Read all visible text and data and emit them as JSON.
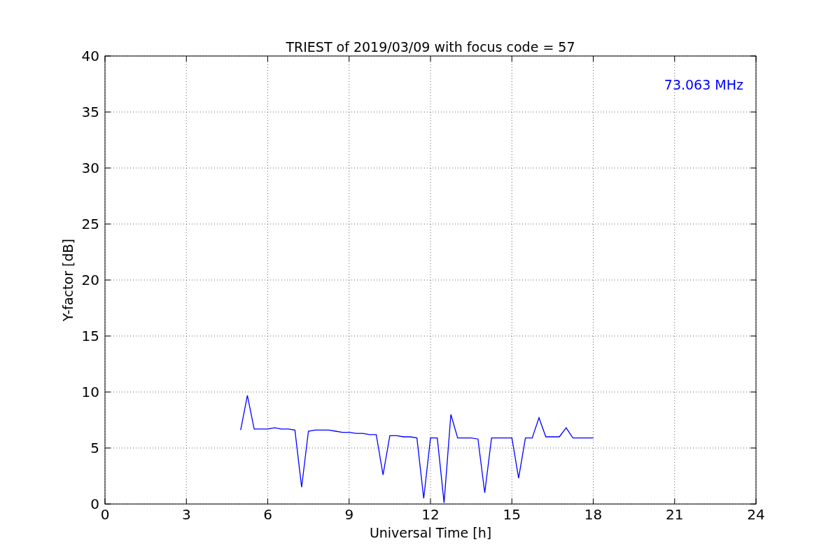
{
  "figure": {
    "chart_data": {
      "type": "line",
      "title": "TRIEST of 2019/03/09 with focus code = 57",
      "xlabel": "Universal Time [h]",
      "ylabel": "Y-factor [dB]",
      "x": [
        5,
        5.25,
        5.5,
        5.75,
        6,
        6.25,
        6.5,
        6.75,
        7,
        7.25,
        7.5,
        7.75,
        8,
        8.25,
        8.5,
        8.75,
        9,
        9.25,
        9.5,
        9.75,
        10,
        10.25,
        10.5,
        10.75,
        11,
        11.25,
        11.5,
        11.75,
        12,
        12.25,
        12.5,
        12.75,
        13,
        13.25,
        13.5,
        13.75,
        14,
        14.25,
        14.5,
        14.75,
        15,
        15.25,
        15.5,
        15.75,
        16,
        16.25,
        16.5,
        16.75,
        17,
        17.25,
        17.5,
        17.75,
        18
      ],
      "series": [
        {
          "name": "73.063 MHz",
          "color": "#0000ff",
          "values": [
            6.6,
            9.7,
            6.7,
            6.7,
            6.7,
            6.8,
            6.7,
            6.7,
            6.6,
            1.5,
            6.5,
            6.6,
            6.6,
            6.6,
            6.5,
            6.4,
            6.4,
            6.3,
            6.3,
            6.2,
            6.2,
            2.6,
            6.1,
            6.1,
            6.0,
            6.0,
            5.9,
            0.5,
            5.9,
            5.9,
            0.1,
            8.0,
            5.9,
            5.9,
            5.9,
            5.8,
            1.0,
            5.9,
            5.9,
            5.9,
            5.9,
            2.3,
            5.9,
            5.9,
            7.7,
            6.0,
            6.0,
            6.0,
            6.8,
            5.9,
            5.9,
            5.9,
            5.9
          ]
        }
      ],
      "xlim": [
        0,
        24
      ],
      "ylim": [
        0,
        40
      ],
      "xticks": [
        0,
        3,
        6,
        9,
        12,
        15,
        18,
        21,
        24
      ],
      "yticks": [
        0,
        5,
        10,
        15,
        20,
        25,
        30,
        35,
        40
      ],
      "grid": true
    }
  }
}
